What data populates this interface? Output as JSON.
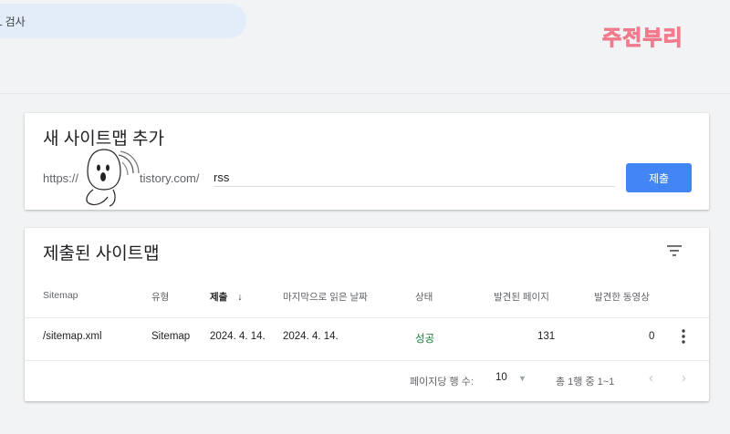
{
  "topbar": {
    "search_label": "L 검사",
    "watermark": "주전부리"
  },
  "add_sitemap": {
    "title": "새 사이트맵 추가",
    "url_prefix": "https://",
    "url_domain": "tistory.com/",
    "input_value": "rss",
    "submit_label": "제출"
  },
  "submitted": {
    "title": "제출된 사이트맵",
    "columns": [
      "Sitemap",
      "유형",
      "제출",
      "마지막으로 읽은 날짜",
      "상태",
      "발견된 페이지",
      "발견한 동영상"
    ],
    "sort_arrow": "↓",
    "rows": [
      {
        "sitemap": "/sitemap.xml",
        "type": "Sitemap",
        "submitted": "2024. 4. 14.",
        "last_read": "2024. 4. 14.",
        "status": "성공",
        "pages": "131",
        "videos": "0"
      }
    ],
    "pagination": {
      "rows_per_page_label": "페이지당 행 수:",
      "rows_per_page": "10",
      "range": "총 1행 중 1~1"
    }
  },
  "colors": {
    "accent": "#4285f4",
    "success": "#188038",
    "watermark": "#f07a8c"
  },
  "icons": {
    "filter": "filter-list-icon",
    "more": "more-vert-icon",
    "prev": "chevron-left-icon",
    "next": "chevron-right-icon",
    "sticker": "sticker-character"
  }
}
